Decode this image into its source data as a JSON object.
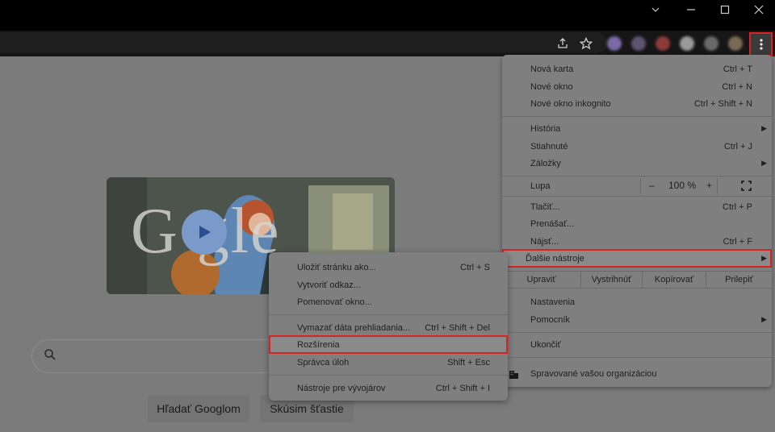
{
  "window_controls": {
    "minimize": "minimize-icon",
    "maximize": "maximize-icon",
    "close": "close-icon"
  },
  "toolbar": {
    "share_icon": "share-icon",
    "bookmark_icon": "star-icon",
    "menu_icon": "three-dots-vertical-icon"
  },
  "page": {
    "search_icon": "search-icon",
    "buttons": {
      "search": "Hľadať Googlom",
      "lucky": "Skúsim šťastie"
    },
    "doodle_letters": "G  gle"
  },
  "menu": {
    "new_tab": {
      "label": "Nová karta",
      "shortcut": "Ctrl + T"
    },
    "new_window": {
      "label": "Nové okno",
      "shortcut": "Ctrl + N"
    },
    "incognito": {
      "label": "Nové okno inkognito",
      "shortcut": "Ctrl + Shift + N"
    },
    "history": {
      "label": "História"
    },
    "downloads": {
      "label": "Stiahnuté",
      "shortcut": "Ctrl + J"
    },
    "bookmarks": {
      "label": "Záložky"
    },
    "zoom": {
      "label": "Lupa",
      "minus": "–",
      "value": "100 %",
      "plus": "+"
    },
    "print": {
      "label": "Tlačiť...",
      "shortcut": "Ctrl + P"
    },
    "cast": {
      "label": "Prenášať..."
    },
    "find": {
      "label": "Nájsť...",
      "shortcut": "Ctrl + F"
    },
    "more_tools": {
      "label": "Ďalšie nástroje"
    },
    "edit": {
      "edit": "Upraviť",
      "cut": "Vystrihnúť",
      "copy": "Kopírovať",
      "paste": "Prilepiť"
    },
    "settings": {
      "label": "Nastavenia"
    },
    "help": {
      "label": "Pomocník"
    },
    "exit": {
      "label": "Ukončiť"
    },
    "managed": {
      "label": "Spravované vašou organizáciou",
      "icon": "building-icon"
    }
  },
  "submenu": {
    "save_page": {
      "label": "Uložiť stránku ako...",
      "shortcut": "Ctrl + S"
    },
    "create_shortcut": {
      "label": "Vytvoriť odkaz..."
    },
    "name_window": {
      "label": "Pomenovať okno..."
    },
    "clear_data": {
      "label": "Vymazať dáta prehliadania...",
      "shortcut": "Ctrl + Shift + Del"
    },
    "extensions": {
      "label": "Rozšírenia"
    },
    "task_manager": {
      "label": "Správca úloh",
      "shortcut": "Shift + Esc"
    },
    "dev_tools": {
      "label": "Nástroje pre vývojárov",
      "shortcut": "Ctrl + Shift + I"
    }
  },
  "colors": {
    "highlight": "#d92323",
    "menu_bg": "#7f7f7f",
    "titlebar": "#000000"
  }
}
